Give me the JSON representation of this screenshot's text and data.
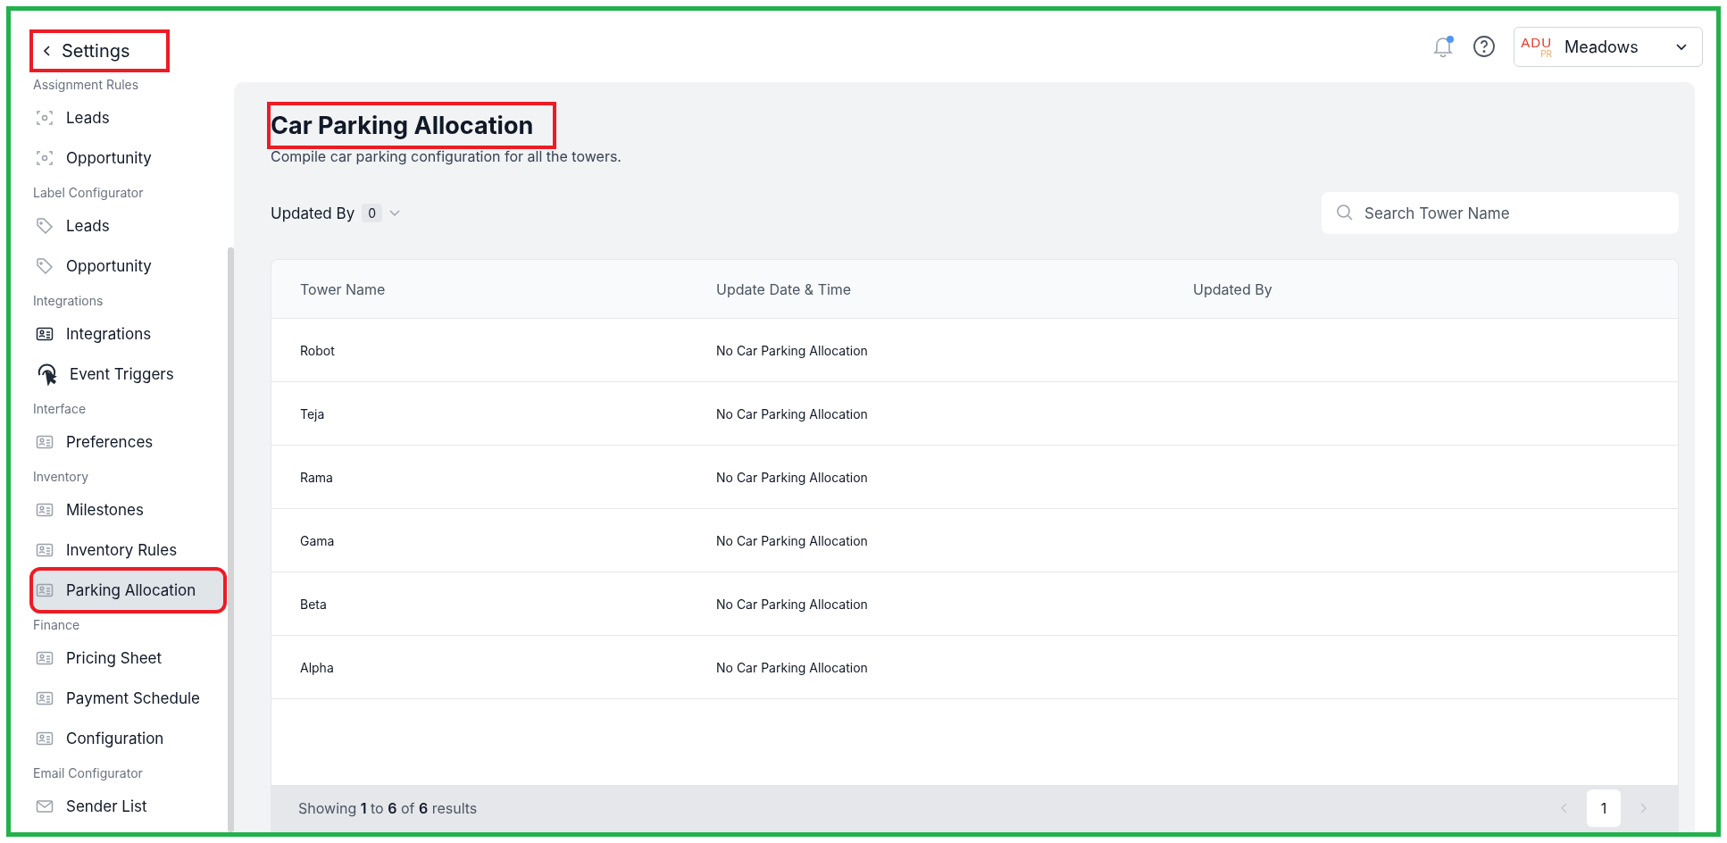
{
  "sidebar": {
    "back": {
      "label": "Settings",
      "highlighted": true
    },
    "sections": [
      {
        "title": "Assignment Rules",
        "items": [
          {
            "label": "Leads",
            "kind": "scan",
            "selected": false,
            "highlighted": false
          },
          {
            "label": "Opportunity",
            "kind": "scan",
            "selected": false,
            "highlighted": false
          }
        ]
      },
      {
        "title": "Label Configurator",
        "items": [
          {
            "label": "Leads",
            "kind": "tag",
            "selected": false,
            "highlighted": false
          },
          {
            "label": "Opportunity",
            "kind": "tag",
            "selected": false,
            "highlighted": false
          }
        ]
      },
      {
        "title": "Integrations",
        "items": [
          {
            "label": "Integrations",
            "kind": "card-dark",
            "selected": false,
            "highlighted": false
          },
          {
            "label": "Event Triggers",
            "kind": "touch",
            "selected": false,
            "highlighted": false
          }
        ]
      },
      {
        "title": "Interface",
        "items": [
          {
            "label": "Preferences",
            "kind": "card",
            "selected": false,
            "highlighted": false
          }
        ]
      },
      {
        "title": "Inventory",
        "items": [
          {
            "label": "Milestones",
            "kind": "card",
            "selected": false,
            "highlighted": false
          },
          {
            "label": "Inventory Rules",
            "kind": "card",
            "selected": false,
            "highlighted": false
          },
          {
            "label": "Parking Allocation",
            "kind": "card",
            "selected": true,
            "highlighted": true
          }
        ]
      },
      {
        "title": "Finance",
        "items": [
          {
            "label": "Pricing Sheet",
            "kind": "card",
            "selected": false,
            "highlighted": false
          },
          {
            "label": "Payment Schedule",
            "kind": "card",
            "selected": false,
            "highlighted": false
          },
          {
            "label": "Configuration",
            "kind": "card",
            "selected": false,
            "highlighted": false
          }
        ]
      },
      {
        "title": "Email Configurator",
        "items": [
          {
            "label": "Sender List",
            "kind": "mail",
            "selected": false,
            "highlighted": false
          }
        ]
      }
    ]
  },
  "topbar": {
    "notification_dot": true,
    "project": {
      "logo_top": "ADU",
      "logo_bottom": "PR",
      "name": "Meadows"
    }
  },
  "page": {
    "title": "Car Parking Allocation",
    "title_highlighted": true,
    "subtitle": "Compile car parking configuration for all the towers.",
    "filter": {
      "label": "Updated By",
      "count": "0"
    },
    "search": {
      "placeholder": "Search Tower Name"
    }
  },
  "table": {
    "columns": [
      "Tower Name",
      "Update Date & Time",
      "Updated By"
    ],
    "rows": [
      [
        "Robot",
        "No Car Parking Allocation"
      ],
      [
        "Teja",
        "No Car Parking Allocation"
      ],
      [
        "Rama",
        "No Car Parking Allocation"
      ],
      [
        "Gama",
        "No Car Parking Allocation"
      ],
      [
        "Beta",
        "No Car Parking Allocation"
      ],
      [
        "Alpha",
        "No Car Parking Allocation"
      ]
    ]
  },
  "footer": {
    "summary": "Showing **1** to **6** of **6** results",
    "pages": [
      {
        "label": "1",
        "selected": true
      }
    ],
    "prev_disabled": true,
    "next_disabled": true
  }
}
